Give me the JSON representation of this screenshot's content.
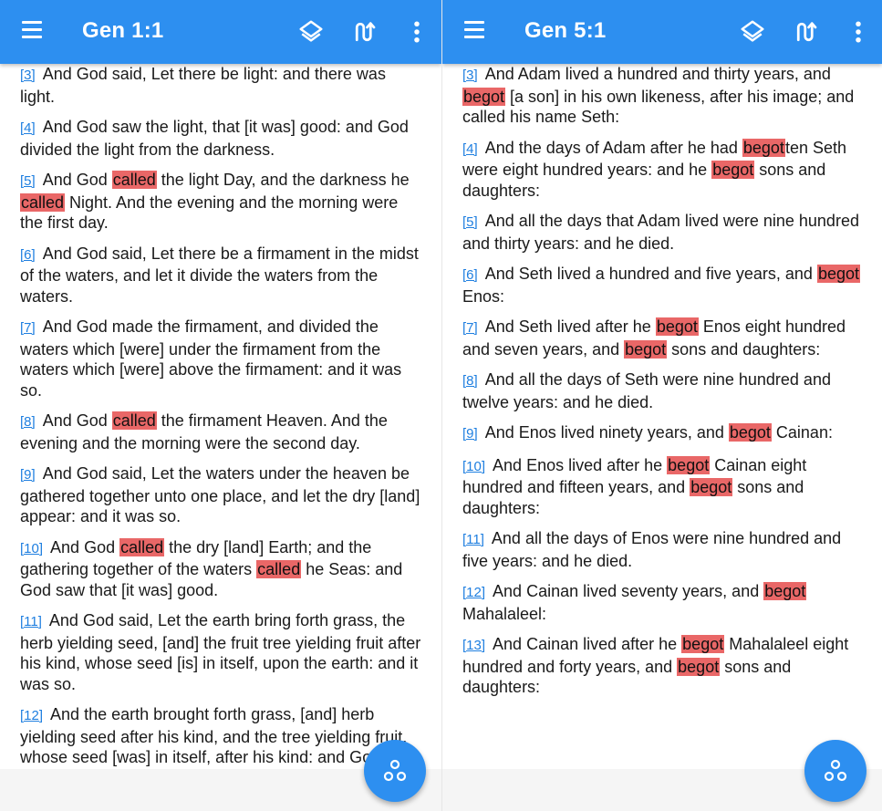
{
  "colors": {
    "accent": "#2d8ff0",
    "highlight": "#e96767",
    "link": "#1f7fe0"
  },
  "icons": {
    "menu": "hamburger-menu-icon",
    "layers": "layers-icon",
    "sync": "parallel-sync-icon",
    "more": "more-vert-icon",
    "fab": "bubble-chart-icon"
  },
  "left": {
    "title": "Gen 1:1",
    "verses": [
      {
        "num": "[3]",
        "parts": [
          {
            "t": " And God said, Let there be light: and there was light."
          }
        ]
      },
      {
        "num": "[4]",
        "parts": [
          {
            "t": " And God saw the light, that [it was] good: and God divided the light from the darkness."
          }
        ]
      },
      {
        "num": "[5]",
        "parts": [
          {
            "t": " And God "
          },
          {
            "t": "called",
            "h": true
          },
          {
            "t": " the light Day, and the darkness he "
          },
          {
            "t": "called",
            "h": true
          },
          {
            "t": " Night. And the evening and the morning were the first day."
          }
        ]
      },
      {
        "num": "[6]",
        "parts": [
          {
            "t": " And God said, Let there be a firmament in the midst of the waters, and let it divide the waters from the waters."
          }
        ]
      },
      {
        "num": "[7]",
        "parts": [
          {
            "t": " And God made the firmament, and divided the waters which [were] under the firmament from the waters which [were] above the firmament: and it was so."
          }
        ]
      },
      {
        "num": "[8]",
        "parts": [
          {
            "t": " And God "
          },
          {
            "t": "called",
            "h": true
          },
          {
            "t": " the firmament Heaven. And the evening and the morning were the second day."
          }
        ]
      },
      {
        "num": "[9]",
        "parts": [
          {
            "t": " And God said, Let the waters under the heaven be gathered together unto one place, and let the dry [land] appear: and it was so."
          }
        ]
      },
      {
        "num": "[10]",
        "parts": [
          {
            "t": " And God "
          },
          {
            "t": "called",
            "h": true
          },
          {
            "t": " the dry [land] Earth; and the gathering together of the waters "
          },
          {
            "t": "called",
            "h": true
          },
          {
            "t": " he Seas: and God saw that [it was] good."
          }
        ]
      },
      {
        "num": "[11]",
        "parts": [
          {
            "t": " And God said, Let the earth bring forth grass, the herb yielding seed, [and] the fruit tree yielding fruit after his kind, whose seed [is] in itself, upon the earth: and it was so."
          }
        ]
      },
      {
        "num": "[12]",
        "parts": [
          {
            "t": " And the earth brought forth grass, [and] herb yielding seed after his kind, and the tree yielding fruit, whose seed [was] in itself, after his kind: and God saw that [it was] good."
          }
        ]
      }
    ]
  },
  "right": {
    "title": "Gen 5:1",
    "verses": [
      {
        "num": "[3]",
        "parts": [
          {
            "t": " And Adam lived a hundred and thirty years, and "
          },
          {
            "t": "begot",
            "h": true
          },
          {
            "t": " [a son] in his own likeness, after his image; and called his name Seth:"
          }
        ]
      },
      {
        "num": "[4]",
        "parts": [
          {
            "t": " And the days of Adam after he had "
          },
          {
            "t": "begot",
            "h": true
          },
          {
            "t": "ten Seth were eight hundred years: and he "
          },
          {
            "t": "begot",
            "h": true
          },
          {
            "t": " sons and daughters:"
          }
        ]
      },
      {
        "num": "[5]",
        "parts": [
          {
            "t": " And all the days that Adam lived were nine hundred and thirty years: and he died."
          }
        ]
      },
      {
        "num": "[6]",
        "parts": [
          {
            "t": " And Seth lived a hundred and five years, and "
          },
          {
            "t": "begot",
            "h": true
          },
          {
            "t": " Enos:"
          }
        ]
      },
      {
        "num": "[7]",
        "parts": [
          {
            "t": " And Seth lived after he "
          },
          {
            "t": "begot",
            "h": true
          },
          {
            "t": " Enos eight hundred and seven years, and "
          },
          {
            "t": "begot",
            "h": true
          },
          {
            "t": " sons and daughters:"
          }
        ]
      },
      {
        "num": "[8]",
        "parts": [
          {
            "t": " And all the days of Seth were nine hundred and twelve years: and he died."
          }
        ]
      },
      {
        "num": "[9]",
        "parts": [
          {
            "t": " And Enos lived ninety years, and "
          },
          {
            "t": "begot",
            "h": true
          },
          {
            "t": " Cainan:"
          }
        ]
      },
      {
        "num": "[10]",
        "parts": [
          {
            "t": " And Enos lived after he "
          },
          {
            "t": "begot",
            "h": true
          },
          {
            "t": " Cainan eight hundred and fifteen years, and "
          },
          {
            "t": "begot",
            "h": true
          },
          {
            "t": " sons and daughters:"
          }
        ]
      },
      {
        "num": "[11]",
        "parts": [
          {
            "t": " And all the days of Enos were nine hundred and five years: and he died."
          }
        ]
      },
      {
        "num": "[12]",
        "parts": [
          {
            "t": " And Cainan lived seventy years, and "
          },
          {
            "t": "begot",
            "h": true
          },
          {
            "t": " Mahalaleel:"
          }
        ]
      },
      {
        "num": "[13]",
        "parts": [
          {
            "t": " And Cainan lived after he "
          },
          {
            "t": "begot",
            "h": true
          },
          {
            "t": " Mahalaleel eight hundred and forty years, and "
          },
          {
            "t": "begot",
            "h": true
          },
          {
            "t": " sons and daughters:"
          }
        ]
      }
    ]
  }
}
